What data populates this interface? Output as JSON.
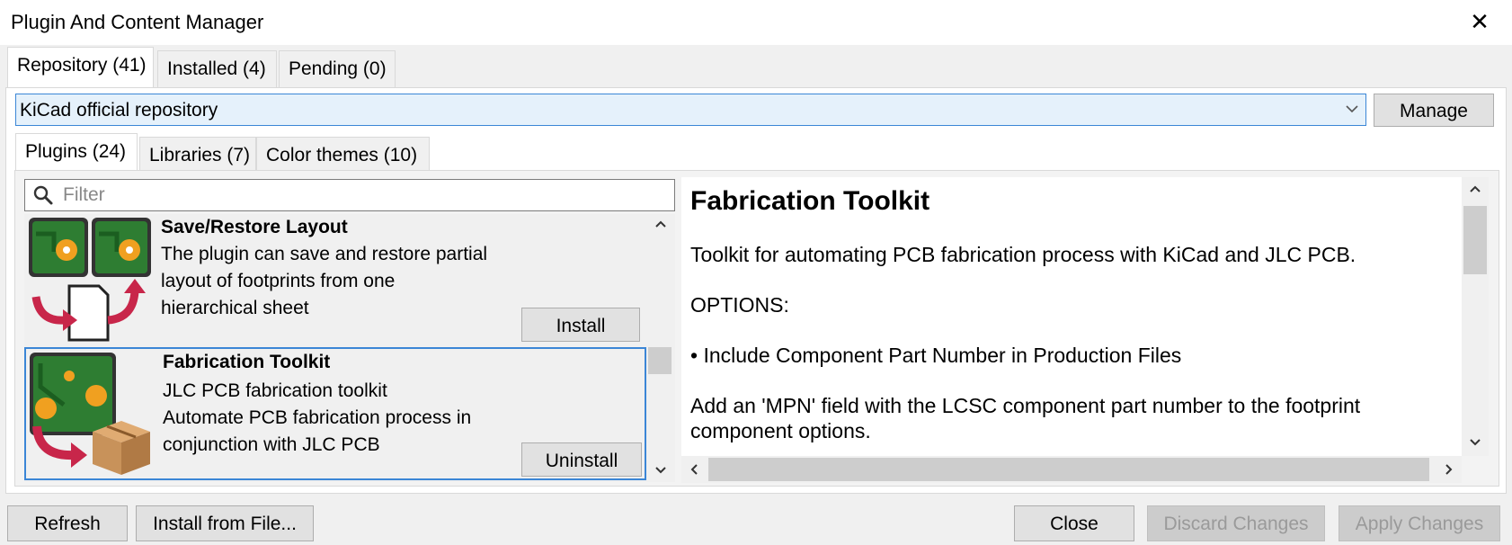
{
  "window": {
    "title": "Plugin And Content Manager",
    "close_glyph": "✕"
  },
  "top_tabs": [
    {
      "label": "Repository (41)",
      "active": true
    },
    {
      "label": "Installed (4)",
      "active": false
    },
    {
      "label": "Pending (0)",
      "active": false
    }
  ],
  "repository": {
    "selected": "KiCad official repository",
    "manage_label": "Manage"
  },
  "content_tabs": [
    {
      "label": "Plugins (24)",
      "active": true
    },
    {
      "label": "Libraries (7)",
      "active": false
    },
    {
      "label": "Color themes (10)",
      "active": false
    }
  ],
  "filter": {
    "placeholder": "Filter",
    "value": ""
  },
  "packages": [
    {
      "name": "Save/Restore Layout",
      "description": [
        "The plugin can save and restore partial",
        "layout of footprints from one",
        "hierarchical sheet"
      ],
      "action_label": "Install",
      "selected": false,
      "icon": "save-restore-layout-icon"
    },
    {
      "name": "Fabrication Toolkit",
      "description": [
        "JLC PCB fabrication toolkit",
        "Automate PCB fabrication process in",
        "conjunction with JLC PCB"
      ],
      "action_label": "Uninstall",
      "selected": true,
      "icon": "fabrication-toolkit-icon"
    }
  ],
  "details": {
    "title": "Fabrication Toolkit",
    "paragraphs": [
      "Toolkit for automating PCB fabrication process with KiCad and JLC PCB.",
      "OPTIONS:",
      "• Include Component Part Number in Production Files",
      "Add an 'MPN' field with the LCSC component part number to the footprint component options."
    ]
  },
  "footer": {
    "refresh_label": "Refresh",
    "install_file_label": "Install from File...",
    "close_label": "Close",
    "discard_label": "Discard Changes",
    "apply_label": "Apply Changes"
  },
  "colors": {
    "accent": "#3b86d6",
    "pcb_green": "#2e7d32",
    "pad_orange": "#f0a020",
    "arrow_red": "#c8264a",
    "box_tan": "#c8925a"
  }
}
